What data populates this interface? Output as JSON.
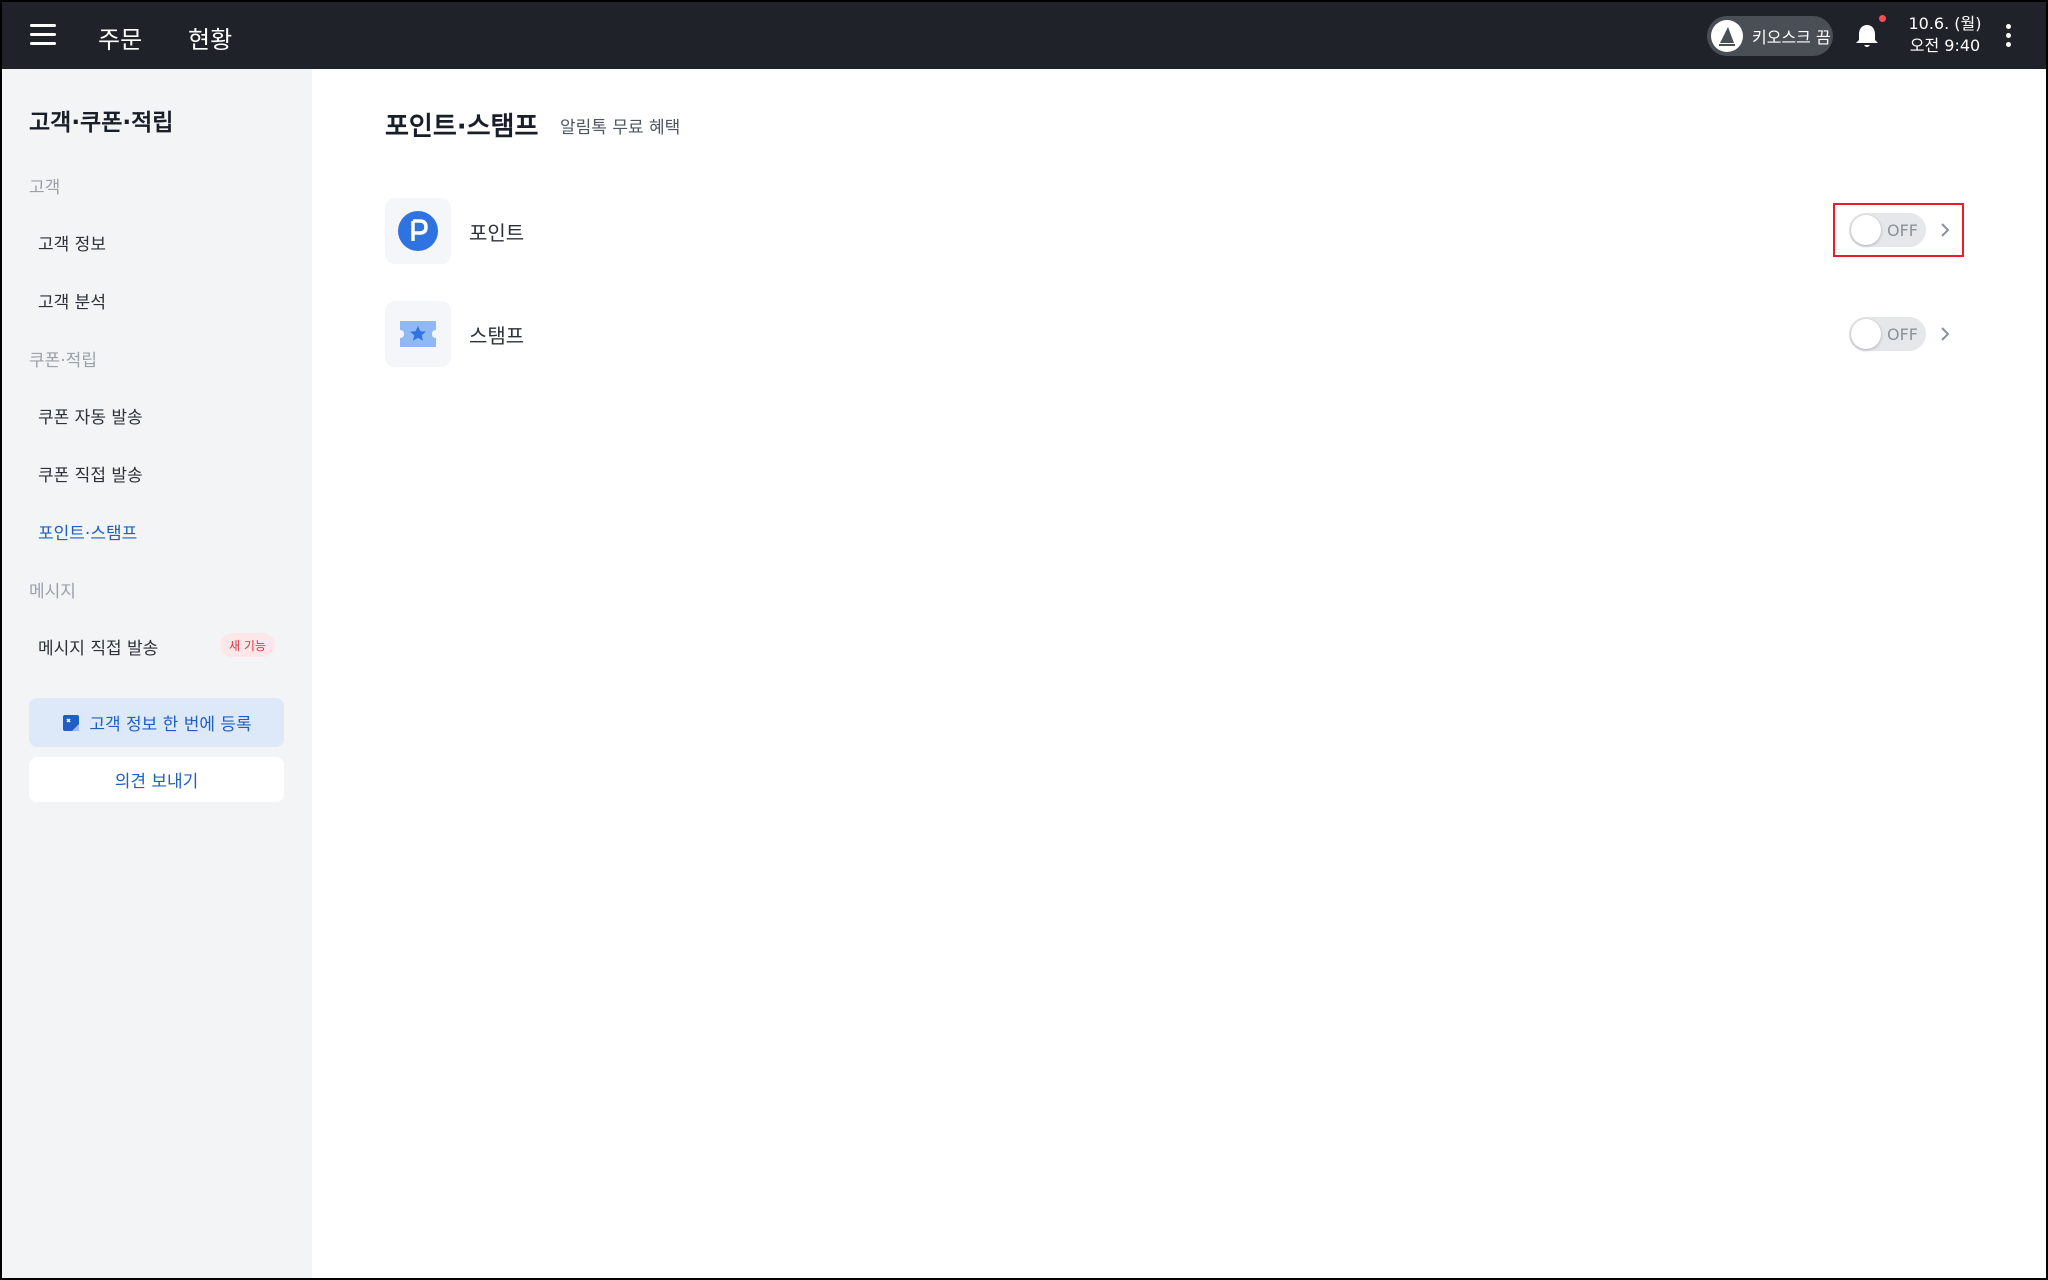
{
  "topbar": {
    "nav": [
      "주문",
      "현황"
    ],
    "kiosk_label": "키오스크 끔",
    "date": "10.6. (월)",
    "time": "오전 9:40"
  },
  "sidebar": {
    "title": "고객·쿠폰·적립",
    "sections": {
      "customer": "고객",
      "coupon": "쿠폰·적립",
      "message": "메시지"
    },
    "items": {
      "customer_info": "고객 정보",
      "customer_analysis": "고객 분석",
      "coupon_auto": "쿠폰 자동 발송",
      "coupon_direct": "쿠폰 직접 발송",
      "point_stamp": "포인트·스탬프",
      "message_direct": "메시지 직접 발송"
    },
    "new_badge": "새 기능",
    "register_button": "고객 정보 한 번에 등록",
    "feedback_button": "의견 보내기"
  },
  "main": {
    "title": "포인트·스탬프",
    "subtitle": "알림톡 무료 혜택",
    "rows": [
      {
        "label": "포인트",
        "toggle": "OFF",
        "icon": "point-p-icon"
      },
      {
        "label": "스탬프",
        "toggle": "OFF",
        "icon": "stamp-ticket-icon"
      }
    ]
  },
  "colors": {
    "topbar_bg": "#1f2329",
    "accent": "#1f5fc4",
    "highlight": "#e61e2b",
    "sidebar_bg": "#f2f4f6"
  }
}
